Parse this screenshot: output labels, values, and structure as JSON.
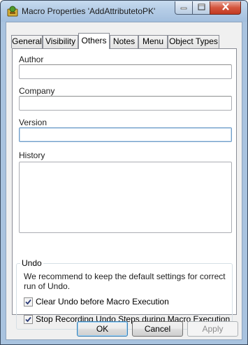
{
  "window": {
    "title": "Macro Properties 'AddAttributetoPK'",
    "icon": "macro-app-icon",
    "controls": [
      "minimize-icon",
      "maximize-icon",
      "close-icon"
    ]
  },
  "tabs": [
    {
      "label": "General",
      "active": false
    },
    {
      "label": "Visibility",
      "active": false
    },
    {
      "label": "Others",
      "active": true
    },
    {
      "label": "Notes",
      "active": false
    },
    {
      "label": "Menu",
      "active": false
    },
    {
      "label": "Object Types",
      "active": false
    }
  ],
  "fields": {
    "author": {
      "label": "Author",
      "value": ""
    },
    "company": {
      "label": "Company",
      "value": ""
    },
    "version": {
      "label": "Version",
      "value": ""
    },
    "history": {
      "label": "History",
      "value": ""
    }
  },
  "undo": {
    "title": "Undo",
    "description": "We recommend to keep the default settings for correct run of Undo.",
    "options": [
      {
        "label": "Clear Undo before Macro Execution",
        "checked": true
      },
      {
        "label": "Stop Recording Undo Steps during Macro Execution",
        "checked": true
      }
    ]
  },
  "buttons": {
    "ok": {
      "label": "OK"
    },
    "cancel": {
      "label": "Cancel"
    },
    "apply": {
      "label": "Apply",
      "enabled": false
    }
  },
  "colors": {
    "titlebar": "#b4cce6",
    "close_button": "#c23a22",
    "dialog_face": "#f0f0f0",
    "focus_border": "#6f9dc9"
  }
}
